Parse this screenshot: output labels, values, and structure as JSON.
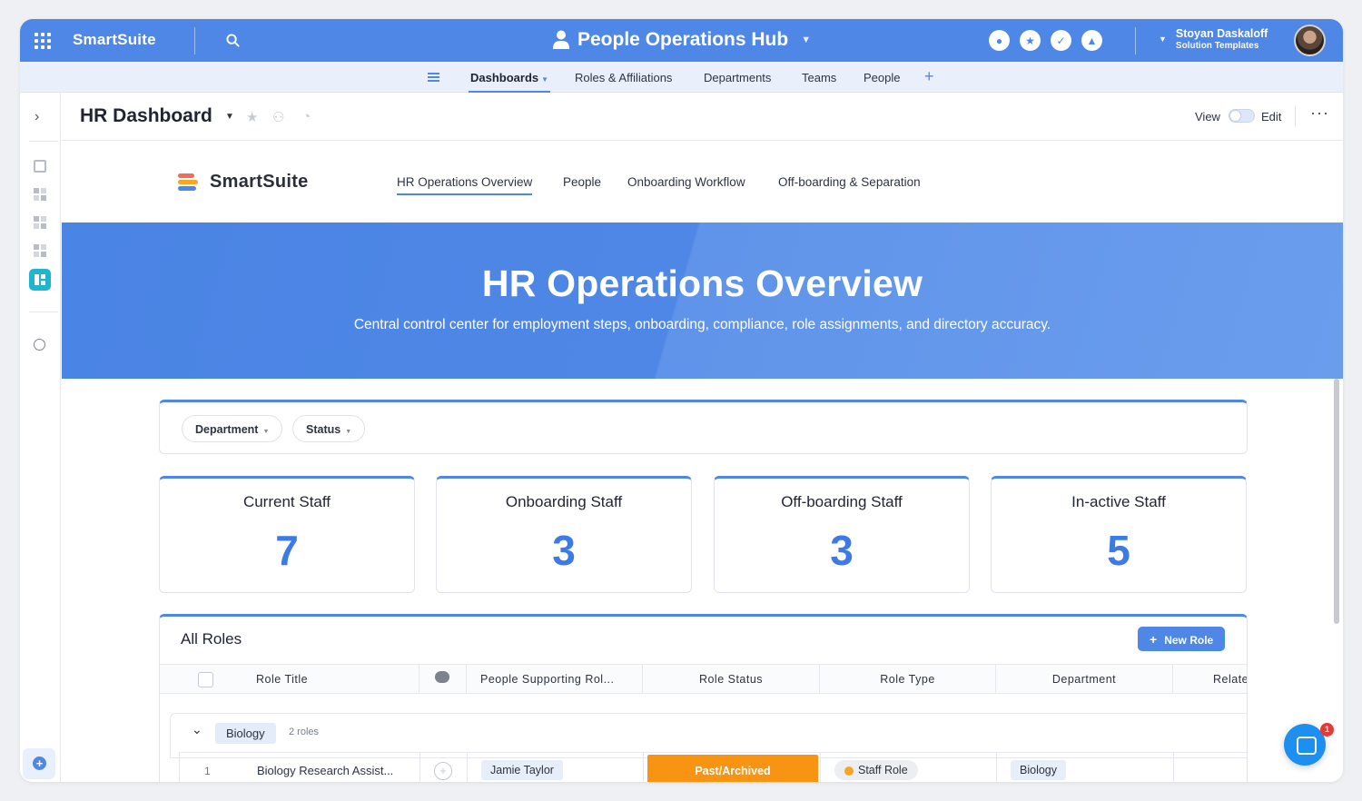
{
  "app": {
    "brand": "SmartSuite",
    "hub_title": "People Operations Hub",
    "user_name": "Stoyan Daskaloff",
    "user_role": "Solution Templates"
  },
  "top_icons": [
    "people-icon",
    "star-icon",
    "check-icon",
    "bell-icon"
  ],
  "nav": {
    "tabs": [
      {
        "label": "Dashboards",
        "active": true
      },
      {
        "label": "Roles & Affiliations",
        "active": false
      },
      {
        "label": "Departments",
        "active": false
      },
      {
        "label": "Teams",
        "active": false
      },
      {
        "label": "People",
        "active": false
      }
    ]
  },
  "dashboard": {
    "title": "HR Dashboard",
    "view_label": "View",
    "edit_label": "Edit"
  },
  "page": {
    "logo_text": "SmartSuite",
    "subtabs": [
      {
        "label": "HR Operations Overview",
        "active": true
      },
      {
        "label": "People",
        "active": false
      },
      {
        "label": "Onboarding Workflow",
        "active": false
      },
      {
        "label": "Off-boarding & Separation",
        "active": false
      }
    ],
    "banner_title": "HR Operations Overview",
    "banner_subtitle": "Central control center for employment steps, onboarding, compliance, role assignments, and directory accuracy."
  },
  "filters": [
    {
      "label": "Department"
    },
    {
      "label": "Status"
    }
  ],
  "stats": [
    {
      "label": "Current Staff",
      "value": "7"
    },
    {
      "label": "Onboarding Staff",
      "value": "3"
    },
    {
      "label": "Off-boarding Staff",
      "value": "3"
    },
    {
      "label": "In-active Staff",
      "value": "5"
    }
  ],
  "roles_table": {
    "title": "All Roles",
    "new_button": "New Role",
    "columns": [
      "Role Title",
      "People Supporting Rol...",
      "Role Status",
      "Role Type",
      "Department",
      "Relate"
    ],
    "group": {
      "name": "Biology",
      "count": "2 roles"
    },
    "rows": [
      {
        "index": "1",
        "title": "Biology Research Assist...",
        "person": "Jamie Taylor",
        "status": "Past/Archived",
        "type": "Staff Role",
        "department": "Biology"
      }
    ]
  },
  "chat": {
    "badge": "1"
  },
  "colors": {
    "primary": "#4f87e6",
    "stat_number": "#3c7be6",
    "status_archived": "#f99413",
    "active_sidebar": "#1fb5cf"
  }
}
